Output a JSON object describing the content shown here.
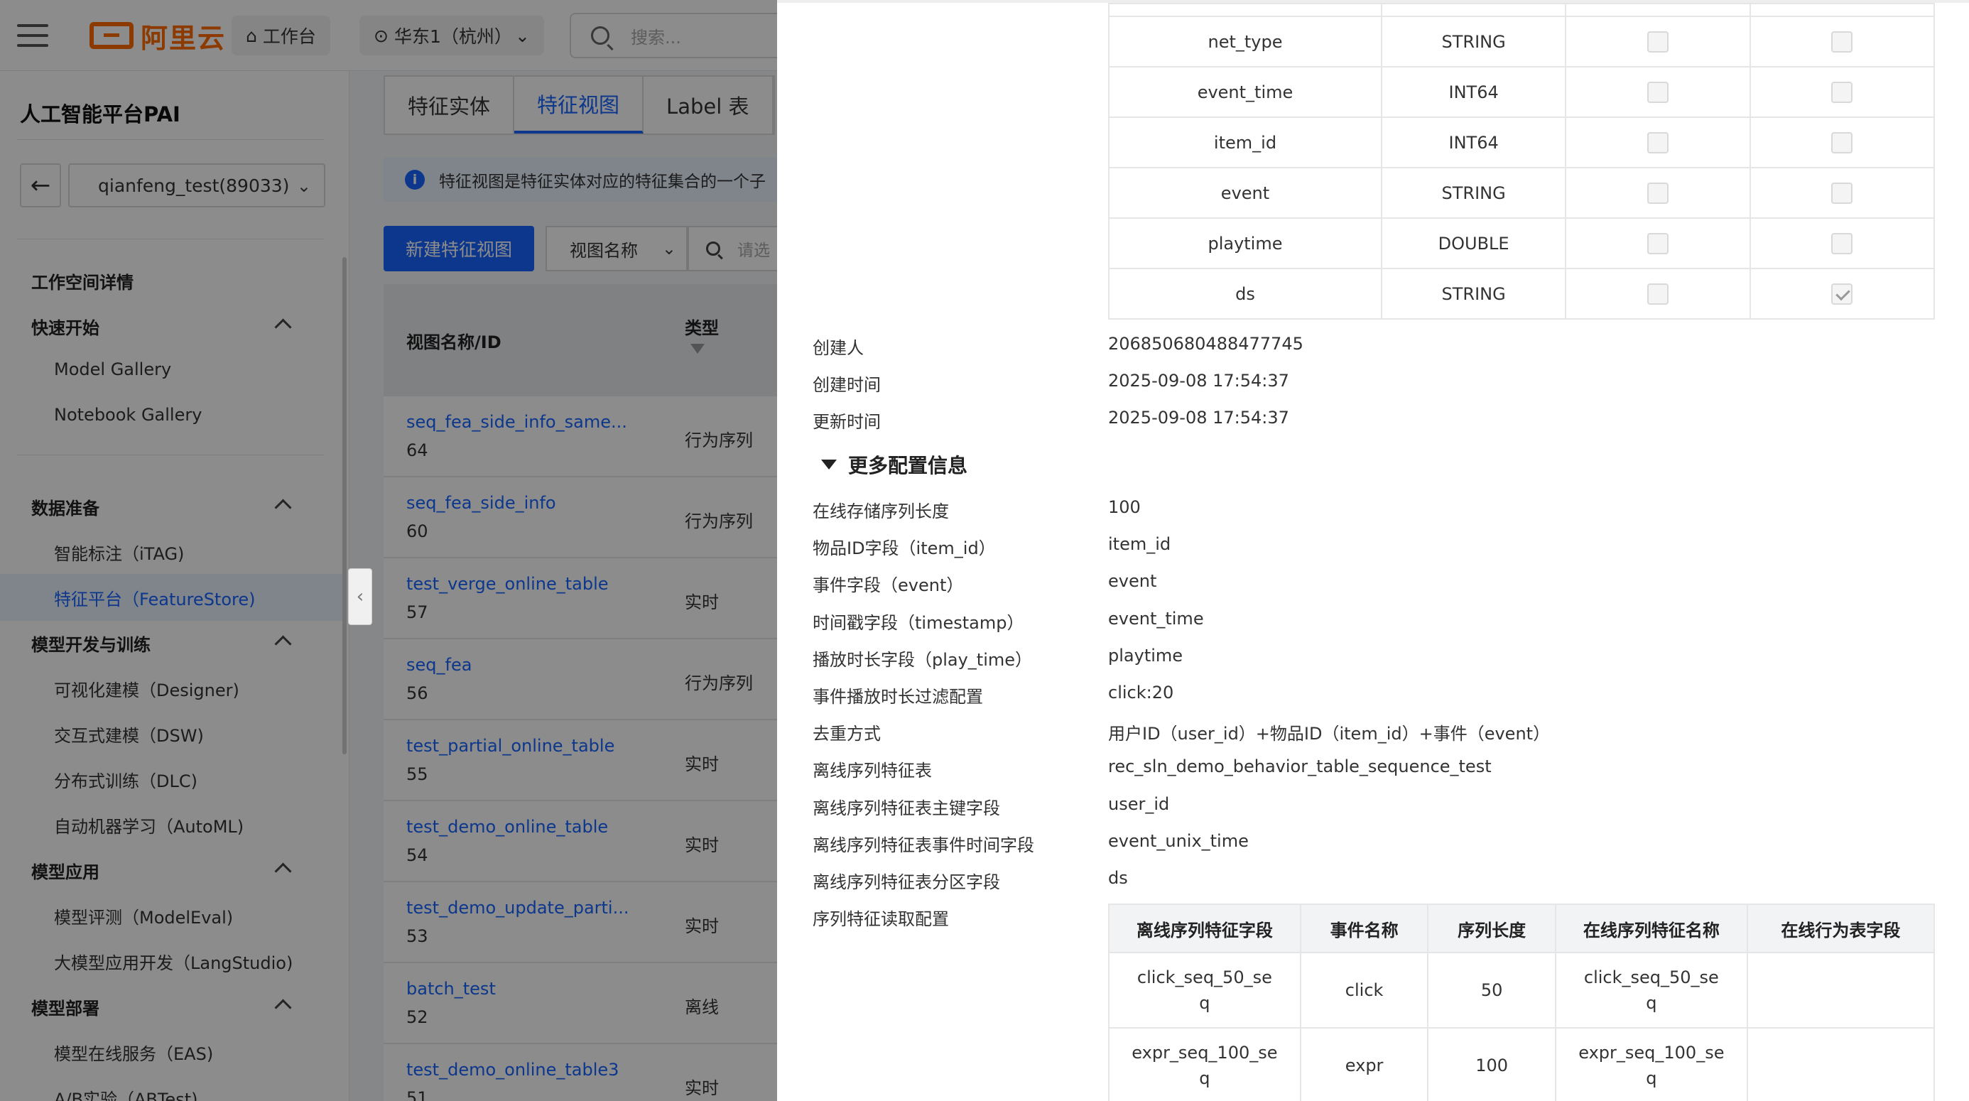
{
  "topbar": {
    "logo_text": "阿里云",
    "workbench_label": "工作台",
    "region_label": "华东1（杭州）",
    "search_placeholder": "搜索..."
  },
  "sidebar": {
    "title": "人工智能平台PAI",
    "workspace": "qianfeng_test(89033)",
    "workspace_details": "工作空间详情",
    "sections": [
      {
        "label": "快速开始",
        "items": [
          "Model Gallery",
          "Notebook Gallery"
        ]
      },
      {
        "label": "数据准备",
        "items": [
          "智能标注（iTAG)",
          "特征平台（FeatureStore)"
        ]
      },
      {
        "label": "模型开发与训练",
        "items": [
          "可视化建模（Designer)",
          "交互式建模（DSW)",
          "分布式训练（DLC)",
          "自动机器学习（AutoML)"
        ]
      },
      {
        "label": "模型应用",
        "items": [
          "模型评测（ModelEval)",
          "大模型应用开发（LangStudio)"
        ]
      },
      {
        "label": "模型部署",
        "items": [
          "模型在线服务（EAS)",
          "A/B实验（ABTest)"
        ]
      }
    ]
  },
  "main": {
    "tabs": [
      "特征实体",
      "特征视图",
      "Label 表"
    ],
    "notice": "特征视图是特征实体对应的特征集合的一个子",
    "new_button": "新建特征视图",
    "filter_select": "视图名称",
    "filter_placeholder": "请选",
    "table_headers": [
      "视图名称/ID",
      "类型"
    ],
    "rows": [
      {
        "name": "seq_fea_side_info_same...",
        "id": "64",
        "type": "行为序列"
      },
      {
        "name": "seq_fea_side_info",
        "id": "60",
        "type": "行为序列"
      },
      {
        "name": "test_verge_online_table",
        "id": "57",
        "type": "实时"
      },
      {
        "name": "seq_fea",
        "id": "56",
        "type": "行为序列"
      },
      {
        "name": "test_partial_online_table",
        "id": "55",
        "type": "实时"
      },
      {
        "name": "test_demo_online_table",
        "id": "54",
        "type": "实时"
      },
      {
        "name": "test_demo_update_parti...",
        "id": "53",
        "type": "实时"
      },
      {
        "name": "batch_test",
        "id": "52",
        "type": "离线"
      },
      {
        "name": "test_demo_online_table3",
        "id": "51",
        "type": "实时"
      }
    ]
  },
  "drawer": {
    "fields": [
      {
        "name": "net_type",
        "type": "STRING",
        "primary": false,
        "partition": false
      },
      {
        "name": "event_time",
        "type": "INT64",
        "primary": false,
        "partition": false
      },
      {
        "name": "item_id",
        "type": "INT64",
        "primary": false,
        "partition": false
      },
      {
        "name": "event",
        "type": "STRING",
        "primary": false,
        "partition": false
      },
      {
        "name": "playtime",
        "type": "DOUBLE",
        "primary": false,
        "partition": false
      },
      {
        "name": "ds",
        "type": "STRING",
        "primary": false,
        "partition": true
      }
    ],
    "basic": [
      {
        "label": "创建人",
        "value": "206850680488477745"
      },
      {
        "label": "创建时间",
        "value": "2025-09-08 17:54:37"
      },
      {
        "label": "更新时间",
        "value": "2025-09-08 17:54:37"
      }
    ],
    "more_config_label": "更多配置信息",
    "config": [
      {
        "label": "在线存储序列长度",
        "value": "100"
      },
      {
        "label": "物品ID字段（item_id）",
        "value": "item_id"
      },
      {
        "label": "事件字段（event）",
        "value": "event"
      },
      {
        "label": "时间戳字段（timestamp）",
        "value": "event_time"
      },
      {
        "label": "播放时长字段（play_time）",
        "value": "playtime"
      },
      {
        "label": "事件播放时长过滤配置",
        "value": "click:20"
      },
      {
        "label": "去重方式",
        "value": "用户ID（user_id）+物品ID（item_id）+事件（event）"
      },
      {
        "label": "离线序列特征表",
        "value": "rec_sln_demo_behavior_table_sequence_test"
      },
      {
        "label": "离线序列特征表主键字段",
        "value": "user_id"
      },
      {
        "label": "离线序列特征表事件时间字段",
        "value": "event_unix_time"
      },
      {
        "label": "离线序列特征表分区字段",
        "value": "ds"
      },
      {
        "label": "序列特征读取配置",
        "value": ""
      }
    ],
    "seq_headers": [
      "离线序列特征字段",
      "事件名称",
      "序列长度",
      "在线序列特征名称",
      "在线行为表字段"
    ],
    "seq_rows": [
      {
        "offline_field_l1": "click_seq_50_se",
        "offline_field_l2": "q",
        "event": "click",
        "length": "50",
        "online_name_l1": "click_seq_50_se",
        "online_name_l2": "q",
        "online_field": ""
      },
      {
        "offline_field_l1": "expr_seq_100_se",
        "offline_field_l2": "q",
        "event": "expr",
        "length": "100",
        "online_name_l1": "expr_seq_100_se",
        "online_name_l2": "q",
        "online_field": ""
      }
    ]
  }
}
